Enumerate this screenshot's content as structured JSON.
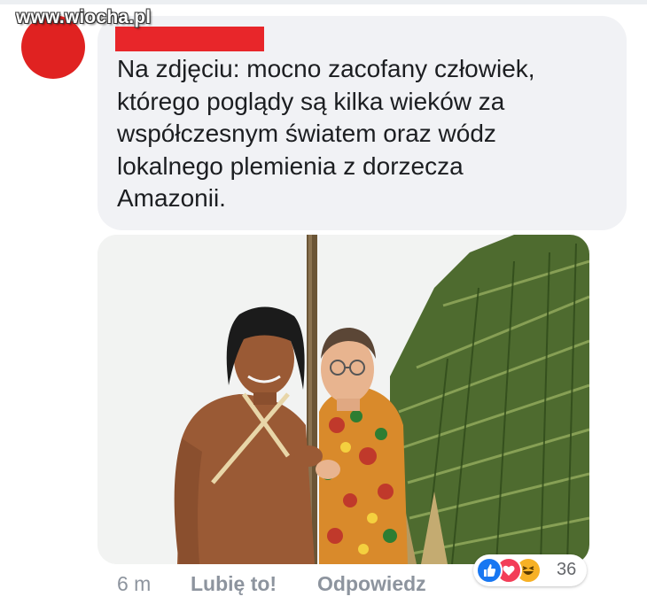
{
  "watermark": {
    "text": "www.wiocha.pl"
  },
  "comment": {
    "author_redacted": true,
    "lines": [
      "Na zdjęciu: mocno zacofany człowiek,",
      "którego poglądy są kilka wieków za",
      "współczesnym światem oraz wódz",
      "lokalnego plemienia z dorzecza",
      "Amazonii."
    ]
  },
  "footer": {
    "time": "6 m",
    "like_label": "Lubię to!",
    "reply_label": "Odpowiedz"
  },
  "reactions": {
    "icons": [
      "like-icon",
      "love-icon",
      "haha-icon"
    ],
    "count": "36"
  },
  "colors": {
    "bubble": "#f1f2f5",
    "redaction": "#e8262a",
    "like_blue": "#1877f2",
    "love_red": "#f33e58",
    "haha_yellow": "#f7b125",
    "meta_grey": "#8d949e"
  }
}
